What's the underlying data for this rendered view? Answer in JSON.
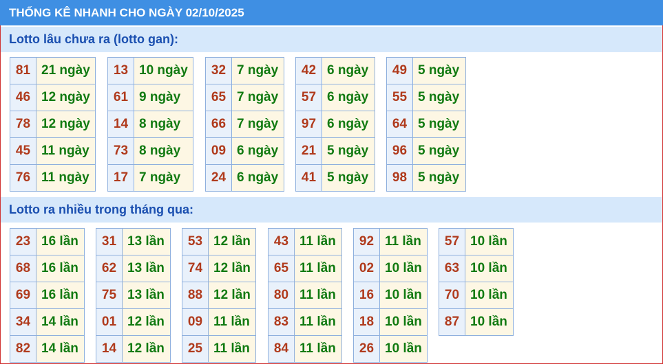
{
  "title": "THỐNG KÊ NHANH CHO NGÀY 02/10/2025",
  "sections": [
    {
      "heading": "Lotto lâu chưa ra (lotto gan):",
      "groups": [
        [
          {
            "num": "81",
            "val": "21 ngày"
          },
          {
            "num": "46",
            "val": "12 ngày"
          },
          {
            "num": "78",
            "val": "12 ngày"
          },
          {
            "num": "45",
            "val": "11 ngày"
          },
          {
            "num": "76",
            "val": "11 ngày"
          }
        ],
        [
          {
            "num": "13",
            "val": "10 ngày"
          },
          {
            "num": "61",
            "val": "9 ngày"
          },
          {
            "num": "14",
            "val": "8 ngày"
          },
          {
            "num": "73",
            "val": "8 ngày"
          },
          {
            "num": "17",
            "val": "7 ngày"
          }
        ],
        [
          {
            "num": "32",
            "val": "7 ngày"
          },
          {
            "num": "65",
            "val": "7 ngày"
          },
          {
            "num": "66",
            "val": "7 ngày"
          },
          {
            "num": "09",
            "val": "6 ngày"
          },
          {
            "num": "24",
            "val": "6 ngày"
          }
        ],
        [
          {
            "num": "42",
            "val": "6 ngày"
          },
          {
            "num": "57",
            "val": "6 ngày"
          },
          {
            "num": "97",
            "val": "6 ngày"
          },
          {
            "num": "21",
            "val": "5 ngày"
          },
          {
            "num": "41",
            "val": "5 ngày"
          }
        ],
        [
          {
            "num": "49",
            "val": "5 ngày"
          },
          {
            "num": "55",
            "val": "5 ngày"
          },
          {
            "num": "64",
            "val": "5 ngày"
          },
          {
            "num": "96",
            "val": "5 ngày"
          },
          {
            "num": "98",
            "val": "5 ngày"
          }
        ]
      ]
    },
    {
      "heading": "Lotto ra nhiều trong tháng qua:",
      "groups": [
        [
          {
            "num": "23",
            "val": "16 lần"
          },
          {
            "num": "68",
            "val": "16 lần"
          },
          {
            "num": "69",
            "val": "16 lần"
          },
          {
            "num": "34",
            "val": "14 lần"
          },
          {
            "num": "82",
            "val": "14 lần"
          }
        ],
        [
          {
            "num": "31",
            "val": "13 lần"
          },
          {
            "num": "62",
            "val": "13 lần"
          },
          {
            "num": "75",
            "val": "13 lần"
          },
          {
            "num": "01",
            "val": "12 lần"
          },
          {
            "num": "14",
            "val": "12 lần"
          }
        ],
        [
          {
            "num": "53",
            "val": "12 lần"
          },
          {
            "num": "74",
            "val": "12 lần"
          },
          {
            "num": "88",
            "val": "12 lần"
          },
          {
            "num": "09",
            "val": "11 lần"
          },
          {
            "num": "25",
            "val": "11 lần"
          }
        ],
        [
          {
            "num": "43",
            "val": "11 lần"
          },
          {
            "num": "65",
            "val": "11 lần"
          },
          {
            "num": "80",
            "val": "11 lần"
          },
          {
            "num": "83",
            "val": "11 lần"
          },
          {
            "num": "84",
            "val": "11 lần"
          }
        ],
        [
          {
            "num": "92",
            "val": "11 lần"
          },
          {
            "num": "02",
            "val": "10 lần"
          },
          {
            "num": "16",
            "val": "10 lần"
          },
          {
            "num": "18",
            "val": "10 lần"
          },
          {
            "num": "26",
            "val": "10 lần"
          }
        ],
        [
          {
            "num": "57",
            "val": "10 lần"
          },
          {
            "num": "63",
            "val": "10 lần"
          },
          {
            "num": "70",
            "val": "10 lần"
          },
          {
            "num": "87",
            "val": "10 lần"
          }
        ]
      ]
    }
  ]
}
